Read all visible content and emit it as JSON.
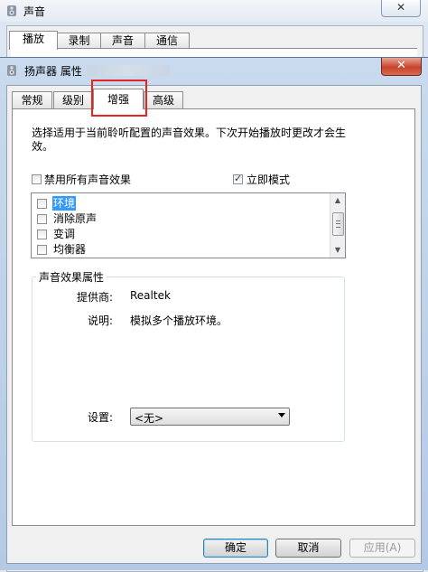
{
  "background_window": {
    "title": "声音",
    "close_symbol": "✕",
    "tabs": [
      "播放",
      "录制",
      "声音",
      "通信"
    ],
    "active_tab": 0
  },
  "dialog": {
    "title": "扬声器 属性",
    "close_symbol": "✕",
    "tabs": [
      "常规",
      "级别",
      "增强",
      "高级"
    ],
    "active_tab": 2,
    "description": "选择适用于当前聆听配置的声音效果。下次开始播放时更改才会生效。",
    "disable_all_label": "禁用所有声音效果",
    "disable_all_checked": false,
    "immediate_mode_label": "立即模式",
    "immediate_mode_checked": true,
    "effects": [
      {
        "label": "环境",
        "checked": false,
        "selected": true
      },
      {
        "label": "消除原声",
        "checked": false,
        "selected": false
      },
      {
        "label": "变调",
        "checked": false,
        "selected": false
      },
      {
        "label": "均衡器",
        "checked": false,
        "selected": false
      }
    ],
    "properties_group": {
      "title": "声音效果属性",
      "provider_label": "提供商:",
      "provider_value": "Realtek",
      "description_label": "说明:",
      "description_value": "模拟多个播放环境。",
      "settings_label": "设置:",
      "settings_value": "<无>"
    },
    "buttons": {
      "ok": "确定",
      "cancel": "取消",
      "apply": "应用(A)"
    }
  },
  "colors": {
    "highlight_box": "#e8221e",
    "selection": "#3399ff",
    "close_button": "#c8422c"
  },
  "icons": {
    "window": "speaker-icon",
    "dialog": "speaker-icon"
  }
}
